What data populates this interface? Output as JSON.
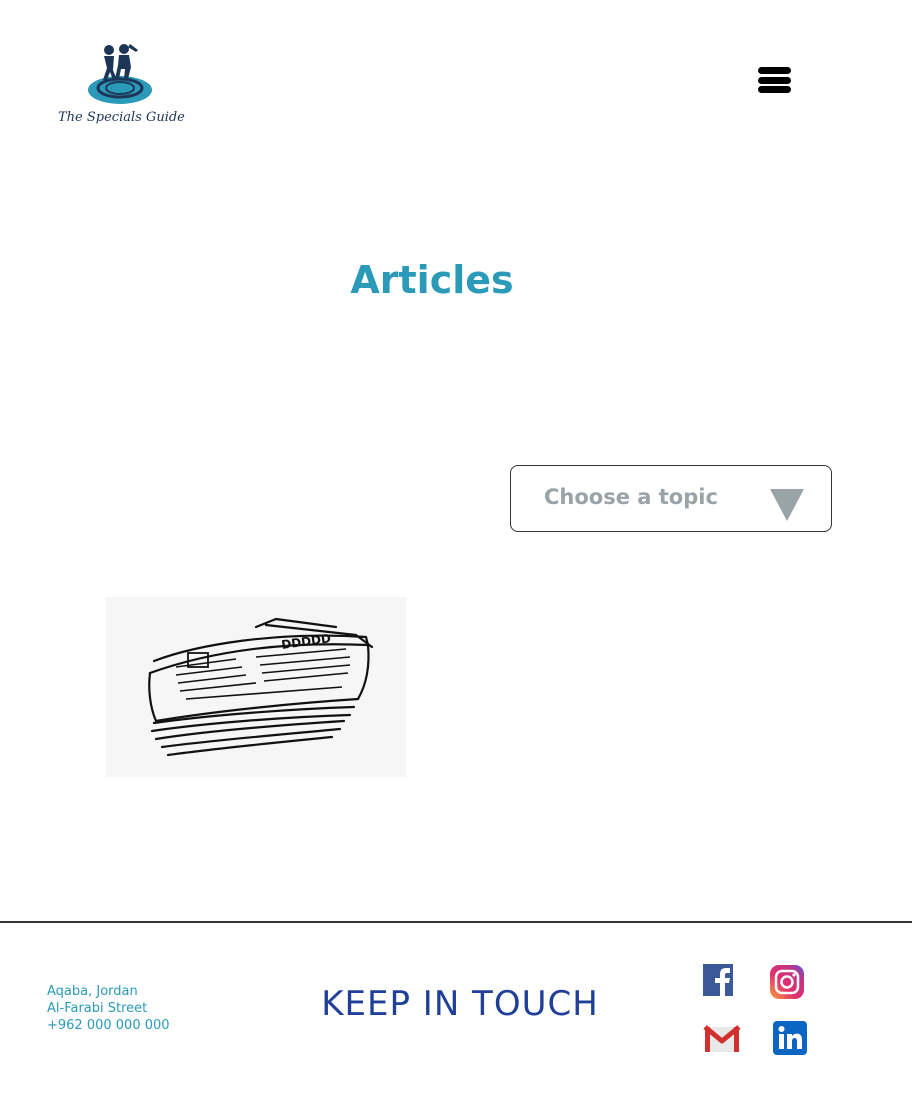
{
  "header": {
    "logo_text": "The Specials Guide",
    "logo_icon": "family-disc-logo-icon",
    "menu_icon": "hamburger-menu-icon"
  },
  "main": {
    "title": "Articles",
    "topic_select": {
      "label": "Choose a topic",
      "icon": "triangle-down-icon"
    },
    "articles": [
      {
        "image": "newspaper-stack-icon"
      }
    ]
  },
  "footer": {
    "address_lines": [
      "Aqaba, Jordan",
      "Al-Farabi Street",
      "+962 000 000 000"
    ],
    "keep_in_touch": "KEEP IN TOUCH",
    "social": [
      "facebook-icon",
      "instagram-icon",
      "gmail-icon",
      "linkedin-icon"
    ]
  },
  "colors": {
    "accent": "#2a9ab8",
    "footer_heading": "#1f3f99",
    "placeholder": "#9aa3a8"
  }
}
